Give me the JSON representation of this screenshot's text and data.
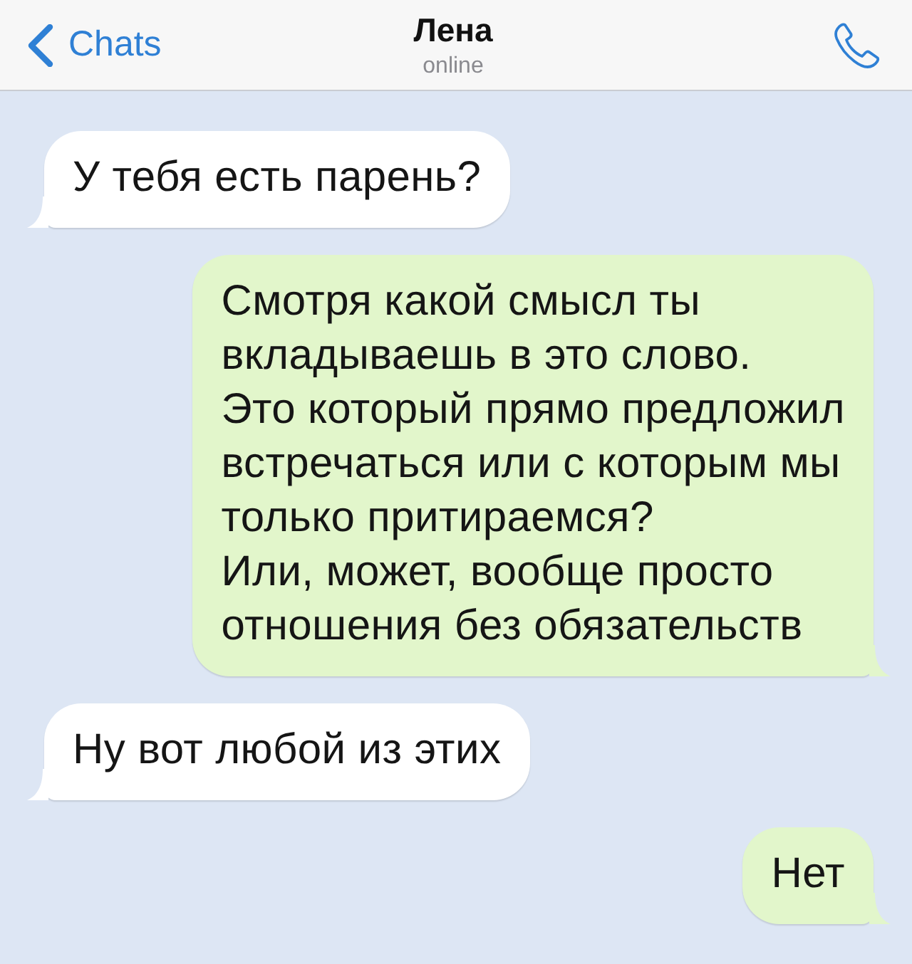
{
  "header": {
    "back": {
      "label": "Chats"
    },
    "contact": {
      "name": "Лена",
      "status": "online"
    }
  },
  "messages": [
    {
      "kind": "incoming",
      "text": "У тебя есть парень?"
    },
    {
      "kind": "outgoing",
      "text": "Смотря какой смысл ты\nвкладываешь в это слово.\nЭто который прямо предложил\nвстречаться или с которым мы\nтолько притираемся?\nИли, может, вообще просто\nотношения без обязательств"
    },
    {
      "kind": "incoming",
      "text": "Ну вот любой из этих"
    },
    {
      "kind": "outgoing",
      "text": "Нет"
    }
  ]
}
